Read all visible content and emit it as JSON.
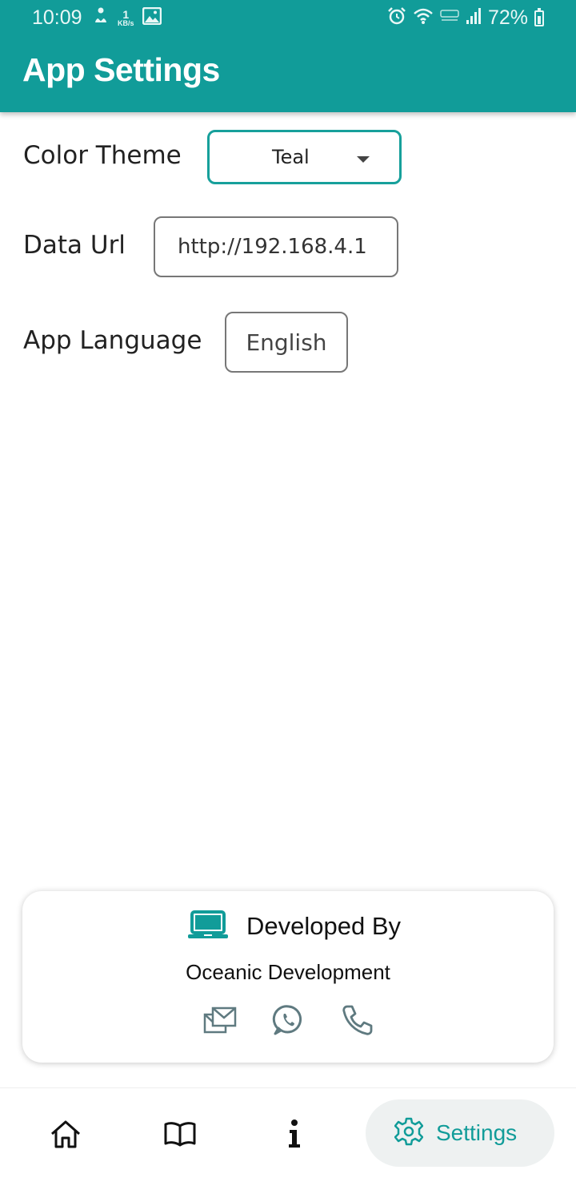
{
  "status_bar": {
    "time": "10:09",
    "network_speed_value": "1",
    "network_speed_unit": "KB/s",
    "battery": "72%"
  },
  "app_bar": {
    "title": "App Settings"
  },
  "settings": {
    "color_theme": {
      "label": "Color Theme",
      "value": "Teal"
    },
    "data_url": {
      "label": "Data Url",
      "value": "http://192.168.4.1"
    },
    "app_language": {
      "label": "App Language",
      "value": "English"
    }
  },
  "developer_card": {
    "title": "Developed By",
    "name": "Oceanic Development",
    "icons": [
      "laptop-icon",
      "email-icon",
      "whatsapp-icon",
      "phone-icon"
    ]
  },
  "bottom_nav": {
    "items": [
      {
        "icon": "home-icon"
      },
      {
        "icon": "book-icon"
      },
      {
        "icon": "info-icon"
      },
      {
        "icon": "gear-icon",
        "label": "Settings",
        "active": true
      }
    ]
  },
  "colors": {
    "primary": "#119c99",
    "card_icon": "#5f7a80",
    "active_nav_bg": "#eef1f1"
  }
}
